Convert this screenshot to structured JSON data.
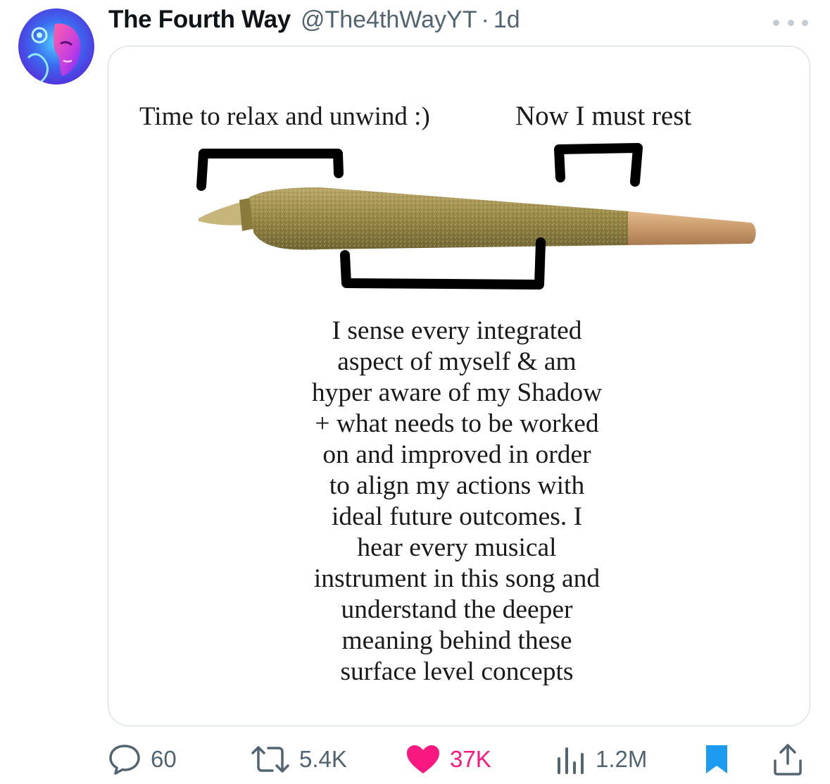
{
  "tweet": {
    "author": {
      "display_name": "The Fourth Way",
      "handle": "@The4thWayYT",
      "separator": "·",
      "time": "1d",
      "avatar": "avatar-image"
    },
    "more_icon": "more-horizontal-icon",
    "media": {
      "label_left": "Time to relax and unwind :)",
      "label_right": "Now I must rest",
      "caption_lines": [
        "I sense every integrated",
        "aspect of myself & am",
        "hyper aware of my Shadow",
        "+ what needs to be worked",
        "on and improved in order",
        "to align my actions with",
        "ideal future outcomes. I",
        "hear every musical",
        "instrument in this song and",
        "understand the deeper",
        "meaning behind these",
        "surface level concepts"
      ]
    },
    "actions": {
      "replies": {
        "icon": "reply-icon",
        "count": "60"
      },
      "retweets": {
        "icon": "retweet-icon",
        "count": "5.4K"
      },
      "likes": {
        "icon": "heart-icon",
        "count": "37K",
        "color": "#f91880"
      },
      "views": {
        "icon": "views-chart-icon",
        "count": "1.2M"
      },
      "bookmark": {
        "icon": "bookmark-icon",
        "color": "#1d9bf0"
      },
      "share": {
        "icon": "share-icon"
      }
    }
  }
}
